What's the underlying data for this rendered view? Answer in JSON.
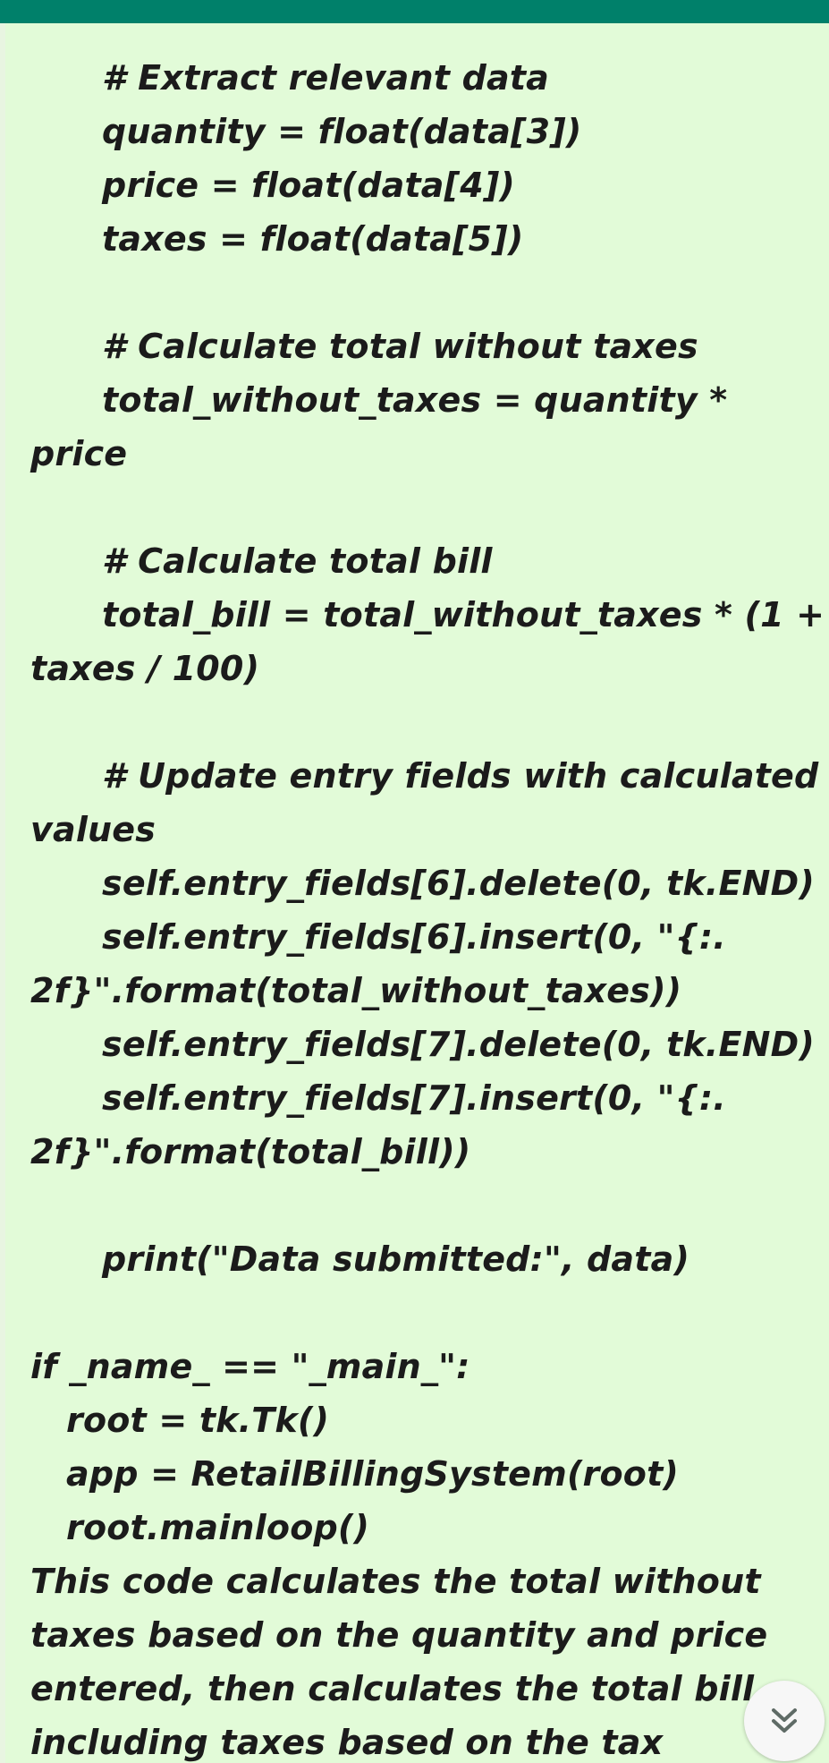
{
  "lines": [
    "# Extract relevant data",
    "quantity = float(data[3])",
    "price = float(data[4])",
    "taxes = float(data[5])",
    "# Calculate total without taxes",
    "total_without_taxes = quantity *",
    "price",
    "# Calculate total bill",
    "total_bill = total_without_taxes * (1 +",
    "taxes / 100)",
    "# Update entry fields with calculated",
    "values",
    "self.entry_fields[6].delete(0, tk.END)",
    "self.entry_fields[6].insert(0, \"{:.",
    "2f}\".format(total_without_taxes))",
    "self.entry_fields[7].delete(0, tk.END)",
    "self.entry_fields[7].insert(0, \"{:.",
    "2f}\".format(total_bill))",
    "print(\"Data submitted:\", data)",
    "if _name_ == \"_main_\":",
    "root = tk.Tk()",
    "app = RetailBillingSystem(root)",
    "root.mainloop()",
    "This code calculates the total without",
    "taxes based on the quantity and price",
    "entered, then calculates the total bill",
    "including taxes based on the tax"
  ],
  "scroll_button": {
    "icon": "double-chevron-down-icon"
  },
  "colors": {
    "top_bar": "#00806a",
    "bubble": "#e2fbd8",
    "text": "#1b1b1b"
  }
}
